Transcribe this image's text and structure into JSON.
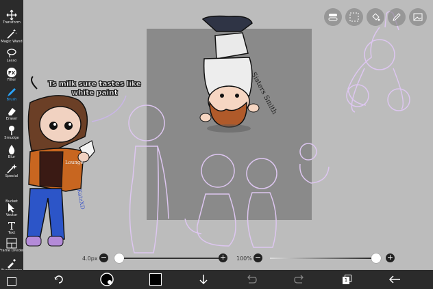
{
  "toolbar": {
    "tools": [
      {
        "label": "Transform",
        "icon": "move-arrows-icon"
      },
      {
        "label": "Magic Wand",
        "icon": "magic-wand-icon"
      },
      {
        "label": "Lasso",
        "icon": "lasso-icon"
      },
      {
        "label": "Filter",
        "icon": "fx-icon",
        "glyph": "FX"
      },
      {
        "label": "Brush",
        "icon": "brush-icon",
        "active": true
      },
      {
        "label": "Eraser",
        "icon": "eraser-icon"
      },
      {
        "label": "Smudge",
        "icon": "smudge-icon"
      },
      {
        "label": "Blur",
        "icon": "drop-icon"
      },
      {
        "label": "Special",
        "icon": "sparkle-wand-icon"
      },
      {
        "label": "Bucket",
        "icon": "bucket-icon"
      },
      {
        "label": "Vector",
        "icon": "vector-cursor-icon"
      },
      {
        "label": "Text",
        "icon": "text-icon",
        "glyph": "T"
      },
      {
        "label": "Frame Divider",
        "icon": "frame-divider-icon"
      },
      {
        "label": "Eyedropper",
        "icon": "eyedropper-icon"
      }
    ],
    "active_color": "#2aa5ff"
  },
  "canvas": {
    "speech_bubble": "Ts milk sure tastes like white paint",
    "sticker_signature": "Sisters Smith",
    "mug_text": "Lounge",
    "artist_signature": "KatzXD"
  },
  "top_icons": [
    "layers-toggle-icon",
    "selection-icon",
    "fill-icon",
    "pencil-icon",
    "image-icon"
  ],
  "sliders": {
    "size_label": "4.0px",
    "size_fraction": 0.0,
    "opacity_label": "100%",
    "opacity_fraction": 1.0,
    "minus": "−",
    "plus": "+"
  },
  "bottombar": {
    "page_number": "1",
    "color": "#000000",
    "icons": [
      "transform-rotate-icon",
      "brush-picker-icon",
      "color-swatch-icon",
      "download-arrow-icon",
      "undo-icon",
      "redo-icon",
      "layers-icon",
      "back-arrow-icon"
    ]
  }
}
